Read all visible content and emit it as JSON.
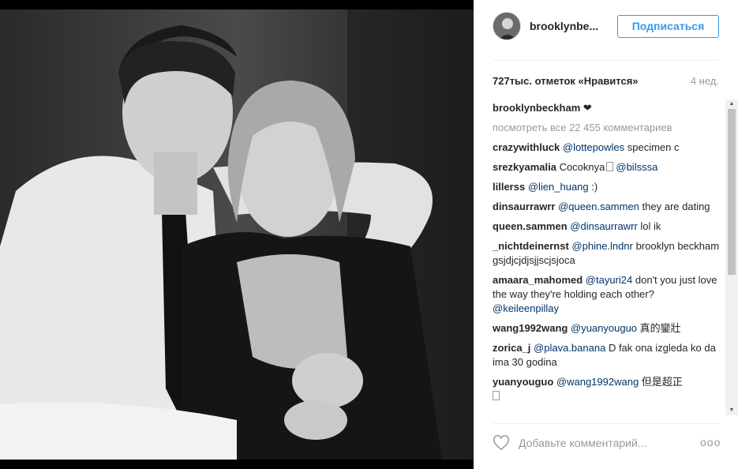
{
  "post": {
    "username": "brooklynbe...",
    "follow_label": "Подписаться",
    "likes": "727тыс. отметок «Нравится»",
    "time": "4 нед.",
    "caption_author": "brooklynbeckham",
    "caption_text": "❤",
    "view_all": "посмотреть все 22 455 комментариев"
  },
  "comments": [
    {
      "author": "crazywithluck",
      "mention": "@lottepowles",
      "text": " specimen c"
    },
    {
      "author": "srezkyamalia",
      "text": " Cocoknya",
      "mention": "@bilsssa",
      "order": "text-first"
    },
    {
      "author": "lillerss",
      "mention": "@lien_huang",
      "text": " :)"
    },
    {
      "author": "dinsaurrawrr",
      "mention": "@queen.sammen",
      "text": " they are dating"
    },
    {
      "author": "queen.sammen",
      "mention": "@dinsaurrawrr",
      "text": " lol ik"
    },
    {
      "author": "_nichtdeinernst",
      "mention": "@phine.lndnr",
      "text": " brooklyn beckham gsjdjcjdjsjjscjsjoca"
    },
    {
      "author": "amaara_mahomed",
      "mention": "@tayuri24",
      "text": " don't you just love the way they're holding each other? ",
      "mention2": "@keileenpillay"
    },
    {
      "author": "wang1992wang",
      "mention": "@yuanyouguo",
      "text": " 真的鑾壯"
    },
    {
      "author": "zorica_j",
      "mention": "@plava.banana",
      "text": " D fak ona izgleda ko da ima 30 godina"
    },
    {
      "author": "yuanyouguo",
      "mention": "@wang1992wang",
      "text": " 但是超正 "
    }
  ],
  "actions": {
    "comment_placeholder": "Добавьте комментарий...",
    "more_label": "ooo"
  },
  "icons": {
    "like": "heart-outline-icon",
    "more": "more-options-icon"
  }
}
